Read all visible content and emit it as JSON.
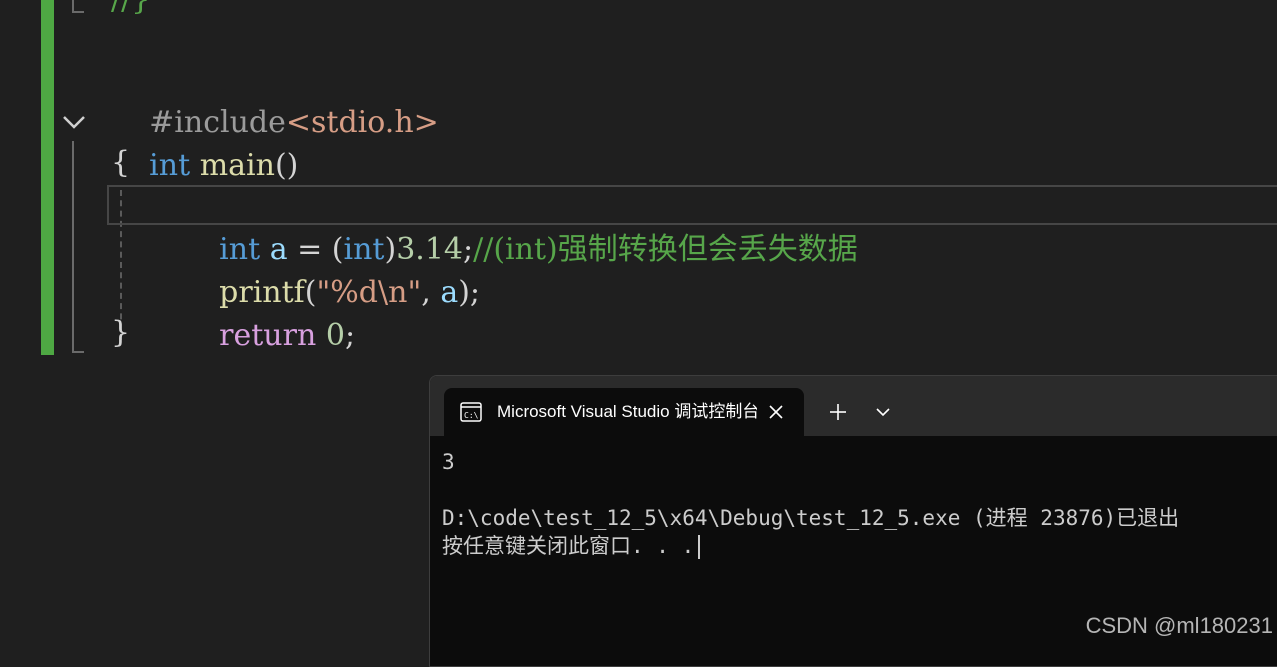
{
  "editor": {
    "top_partial": "//}",
    "lines": {
      "include": {
        "directive": "#include",
        "header": "<stdio.h>"
      },
      "main_sig": {
        "type": "int",
        "name": "main",
        "parens": "()"
      },
      "open_brace": "{",
      "decl": {
        "type": "int",
        "var": "a",
        "eq": " = ",
        "lparen": "(",
        "cast": "int",
        "rparen": ")",
        "num": "3.14",
        "semi": ";",
        "comment": "//(int)强制转换但会丢失数据"
      },
      "printf": {
        "fn": "printf",
        "lparen": "(",
        "fmt": "\"%d\\n\"",
        "comma": ", ",
        "arg": "a",
        "end": ");"
      },
      "ret": {
        "kw": "return",
        "num": "0",
        "semi": ";"
      },
      "close_brace": "}"
    }
  },
  "terminal": {
    "tab_title": "Microsoft Visual Studio 调试控制台",
    "icons": {
      "tab": "console-icon",
      "close": "close-icon",
      "new_tab": "plus-icon",
      "dropdown": "chevron-down-icon"
    },
    "output": [
      "3",
      "",
      "D:\\code\\test_12_5\\x64\\Debug\\test_12_5.exe (进程 23876)已退出",
      "按任意键关闭此窗口. . ."
    ]
  },
  "watermark": "CSDN @ml180231",
  "colors": {
    "keyword": "#569cd6",
    "function": "#dcdcaa",
    "comment": "#57a64a",
    "string": "#d69d85",
    "control": "#d8a0df",
    "change_bar": "#4ea843"
  }
}
